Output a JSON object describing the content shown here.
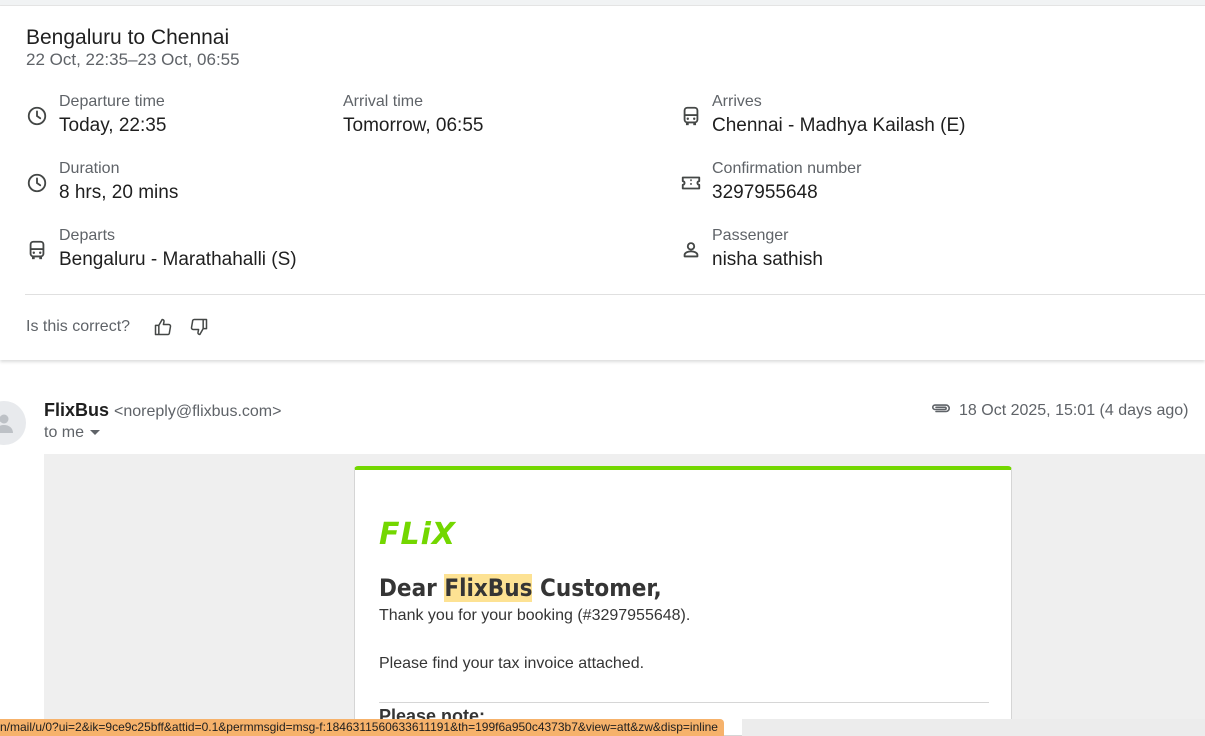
{
  "trip": {
    "title": "Bengaluru to Chennai",
    "subtitle": "22 Oct, 22:35–23 Oct, 06:55",
    "departure_time": {
      "label": "Departure time",
      "value": "Today, 22:35",
      "icon": "clock-icon"
    },
    "arrival_time": {
      "label": "Arrival time",
      "value": "Tomorrow, 06:55"
    },
    "arrives": {
      "label": "Arrives",
      "value": "Chennai - Madhya Kailash (E)",
      "icon": "bus-icon"
    },
    "duration": {
      "label": "Duration",
      "value": "8 hrs, 20 mins",
      "icon": "clock-icon"
    },
    "confirmation": {
      "label": "Confirmation number",
      "value": "3297955648",
      "icon": "ticket-icon"
    },
    "departs": {
      "label": "Departs",
      "value": "Bengaluru - Marathahalli (S)",
      "icon": "bus-icon"
    },
    "passenger": {
      "label": "Passenger",
      "value": "nisha sathish",
      "icon": "person-icon"
    },
    "feedback": {
      "question": "Is this correct?"
    }
  },
  "email": {
    "sender_name": "FlixBus",
    "sender_address": "<noreply@flixbus.com>",
    "recipient": "to me",
    "date": "18 Oct 2025, 15:01 (4 days ago)",
    "body": {
      "logo": "FLiX",
      "greeting_prefix": "Dear ",
      "greeting_highlight": "FlixBus",
      "greeting_suffix": " Customer,",
      "line1": "Thank you for your booking (#3297955648).",
      "line2": "Please find your tax invoice attached.",
      "note": "Please note:"
    }
  },
  "statusbar": {
    "url": "n/mail/u/0?ui=2&ik=9ce9c25bff&attid=0.1&permmsgid=msg-f:1846311560633611191&th=199f6a950c4373b7&view=att&zw&disp=inline"
  },
  "colors": {
    "accent": "#73d700",
    "highlight": "#fde293",
    "statusbar": "#f6b26b"
  }
}
